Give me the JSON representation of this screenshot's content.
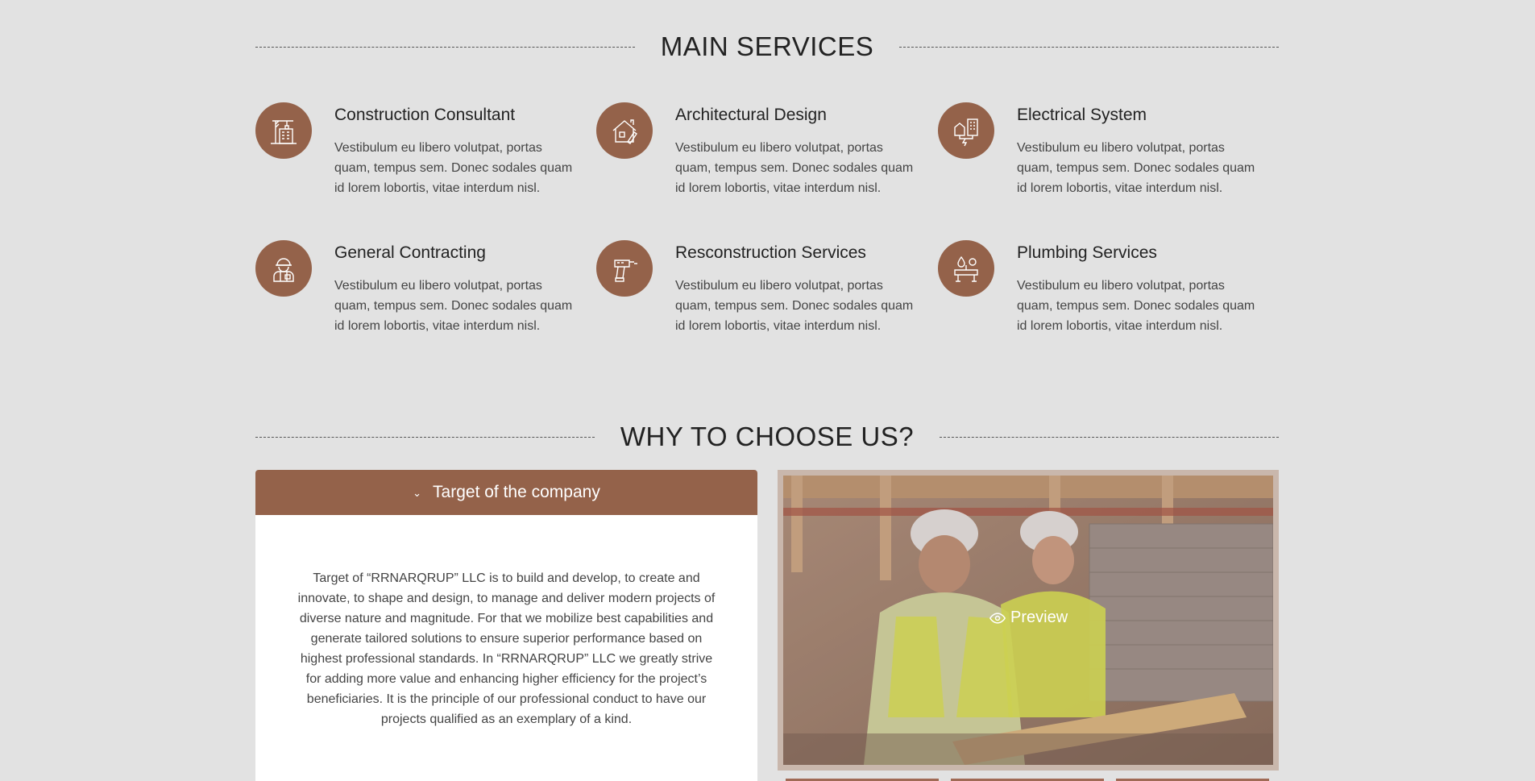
{
  "main_services": {
    "title": "MAIN SERVICES",
    "items": [
      {
        "title": "Construction Consultant",
        "text": "Vestibulum eu libero volutpat, portas quam, tempus sem. Donec sodales quam id lorem lobortis, vitae interdum nisl.",
        "icon": "crane-building-icon"
      },
      {
        "title": "Architectural Design",
        "text": "Vestibulum eu libero volutpat, portas quam, tempus sem. Donec sodales quam id lorem lobortis, vitae interdum nisl.",
        "icon": "house-ruler-icon"
      },
      {
        "title": "Electrical System",
        "text": "Vestibulum eu libero volutpat, portas quam, tempus sem. Donec sodales quam id lorem lobortis, vitae interdum nisl.",
        "icon": "electrical-building-icon"
      },
      {
        "title": "General Contracting",
        "text": "Vestibulum eu libero volutpat, portas quam, tempus sem. Donec sodales quam id lorem lobortis, vitae interdum nisl.",
        "icon": "worker-helmet-icon"
      },
      {
        "title": "Resconstruction Services",
        "text": "Vestibulum eu libero volutpat, portas quam, tempus sem. Donec sodales quam id lorem lobortis, vitae interdum nisl.",
        "icon": "drill-icon"
      },
      {
        "title": "Plumbing Services",
        "text": "Vestibulum eu libero volutpat, portas quam, tempus sem. Donec sodales quam id lorem lobortis, vitae interdum nisl.",
        "icon": "plumbing-pipes-icon"
      }
    ]
  },
  "why": {
    "title": "WHY TO CHOOSE US?",
    "accordion": {
      "label": "Target of the company",
      "text": "Target of “RRNARQRUP” LLC is to build and develop, to create and innovate, to shape and design, to manage and deliver modern projects of diverse nature and magnitude. For that we mobilize best capabilities and generate tailored solutions to ensure superior performance based on highest professional standards. In “RRNARQRUP” LLC  we greatly strive for adding more value and enhancing higher efficiency for the project’s beneficiaries. It is the principle of our professional conduct to have our projects qualified as an exemplary of a kind."
    },
    "preview_label": "Preview"
  },
  "colors": {
    "accent": "#94624a",
    "background": "#e2e2e2"
  }
}
